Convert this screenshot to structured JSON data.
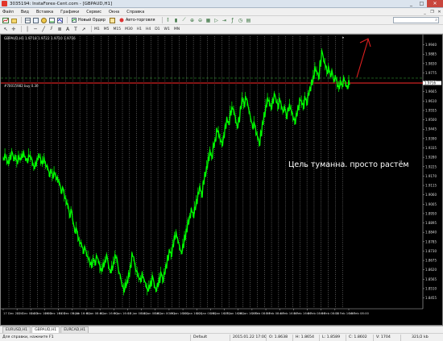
{
  "window": {
    "title": "3035194: InstaForex-Cent.com - [GBPAUD,H1]",
    "buttons": [
      "_",
      "□",
      "✕"
    ]
  },
  "menu": [
    "Файл",
    "Вид",
    "Вставка",
    "Графики",
    "Сервис",
    "Окна",
    "Справка"
  ],
  "toolbar": {
    "new_order": "Новый Ордер",
    "autotrading": "Авто-торговля",
    "search_placeholder": ""
  },
  "timeframes": [
    "M1",
    "M5",
    "M15",
    "M30",
    "H1",
    "H4",
    "D1",
    "W1",
    "MN"
  ],
  "chart": {
    "symbol_label": "GBPAUD,H1  1.9718 1.9722 1.9710 1.9716",
    "order_label": "#70015982 buy 0.30",
    "annotation": "Цель туманна. просто растём",
    "colors": {
      "background": "#000000",
      "candles": "#00ff00",
      "grid": "#c8c8c8",
      "order_line": "#ff2a2a",
      "order_dash": "#2e8b2e",
      "arrow": "#e02020"
    }
  },
  "chart_data": {
    "type": "line",
    "symbol": "GBPAUD",
    "timeframe": "H1",
    "x_tick_labels": [
      "17 Dec 2014",
      "22 Dec 08:00",
      "24 Dec 16:00",
      "29 Dec 16:00",
      "31 Dec 00:00",
      "5 Jan 16:00",
      "6 Jan 08:00",
      "8 Jan 16:00",
      "9 Jan 16:00",
      "13 Jan 08:00",
      "14 Jan 08:00",
      "16 Jan 00:00",
      "19 Jan 16:00",
      "20 Jan 16:00",
      "22 Jan 00:00",
      "26 Jan 16:00",
      "27 Jan 16:00",
      "28 Jan 16:00",
      "2 Feb 08:00",
      "3 Feb 08:00",
      "4 Feb 16:00",
      "5 Feb 16:00",
      "6 Feb 08:00",
      "9 Feb 08:00",
      "11 Feb 16:00",
      "16 Feb 08:00"
    ],
    "y_tick_labels": [
      "1.9940",
      "1.9885",
      "1.9830",
      "1.9775",
      "1.9720",
      "1.9665",
      "1.9610",
      "1.9555",
      "1.9500",
      "1.9445",
      "1.9390",
      "1.9335",
      "1.9280",
      "1.9225",
      "1.9170",
      "1.9115",
      "1.9060",
      "1.9005",
      "1.8950",
      "1.8895",
      "1.8840",
      "1.8785",
      "1.8730",
      "1.8675",
      "1.8620",
      "1.8565",
      "1.8510",
      "1.8455"
    ],
    "ylim": [
      1.842,
      1.999
    ],
    "current_price": "1.9716",
    "order_price": 1.9716,
    "y": [
      1.927,
      1.929,
      1.926,
      1.925,
      1.928,
      1.931,
      1.927,
      1.928,
      1.925,
      1.928,
      1.927,
      1.929,
      1.93,
      1.927,
      1.926,
      1.929,
      1.928,
      1.925,
      1.922,
      1.924,
      1.927,
      1.929,
      1.926,
      1.925,
      1.927,
      1.923,
      1.922,
      1.918,
      1.92,
      1.917,
      1.919,
      1.916,
      1.915,
      1.913,
      1.908,
      1.91,
      1.905,
      1.902,
      1.9,
      1.894,
      1.897,
      1.89,
      1.885,
      1.886,
      1.881,
      1.878,
      1.877,
      1.873,
      1.875,
      1.871,
      1.869,
      1.866,
      1.865,
      1.868,
      1.866,
      1.87,
      1.867,
      1.863,
      1.862,
      1.865,
      1.867,
      1.87,
      1.864,
      1.861,
      1.863,
      1.866,
      1.87,
      1.868,
      1.861,
      1.858,
      1.853,
      1.85,
      1.853,
      1.855,
      1.859,
      1.864,
      1.871,
      1.868,
      1.862,
      1.86,
      1.857,
      1.856,
      1.859,
      1.856,
      1.853,
      1.85,
      1.852,
      1.854,
      1.858,
      1.853,
      1.85,
      1.853,
      1.856,
      1.86,
      1.856,
      1.86,
      1.864,
      1.869,
      1.873,
      1.871,
      1.876,
      1.881,
      1.883,
      1.879,
      1.875,
      1.872,
      1.876,
      1.881,
      1.885,
      1.89,
      1.893,
      1.897,
      1.894,
      1.898,
      1.902,
      1.907,
      1.91,
      1.906,
      1.913,
      1.918,
      1.922,
      1.927,
      1.931,
      1.928,
      1.935,
      1.938,
      1.944,
      1.942,
      1.938,
      1.936,
      1.94,
      1.946,
      1.95,
      1.948,
      1.954,
      1.957,
      1.955,
      1.95,
      1.946,
      1.95,
      1.957,
      1.962,
      1.959,
      1.963,
      1.96,
      1.955,
      1.95,
      1.946,
      1.948,
      1.943,
      1.94,
      1.936,
      1.942,
      1.948,
      1.953,
      1.958,
      1.962,
      1.96,
      1.957,
      1.961,
      1.965,
      1.961,
      1.958,
      1.962,
      1.958,
      1.955,
      1.957,
      1.952,
      1.956,
      1.958,
      1.955,
      1.951,
      1.949,
      1.953,
      1.957,
      1.962,
      1.96,
      1.958,
      1.963,
      1.96,
      1.965,
      1.968,
      1.972,
      1.975,
      1.98,
      1.978,
      1.975,
      1.983,
      1.99,
      1.985,
      1.982,
      1.978,
      1.98,
      1.976,
      1.978,
      1.973,
      1.975,
      1.971,
      1.969,
      1.972,
      1.97,
      1.974,
      1.971,
      1.969,
      1.972
    ]
  },
  "tabs": [
    "EURUSD,H1",
    "GBPAUD,H1",
    "EURCAD,H1"
  ],
  "active_tab": 1,
  "status": {
    "help": "Для справки, нажмите F1",
    "profile": "Default",
    "datetime": "2015.01.22 17:00",
    "open": "O: 1.8638",
    "high": "H: 1.8654",
    "low": "L: 1.8589",
    "close": "C: 1.8602",
    "volume": "V: 1704",
    "traffic": "321/2 kb"
  }
}
